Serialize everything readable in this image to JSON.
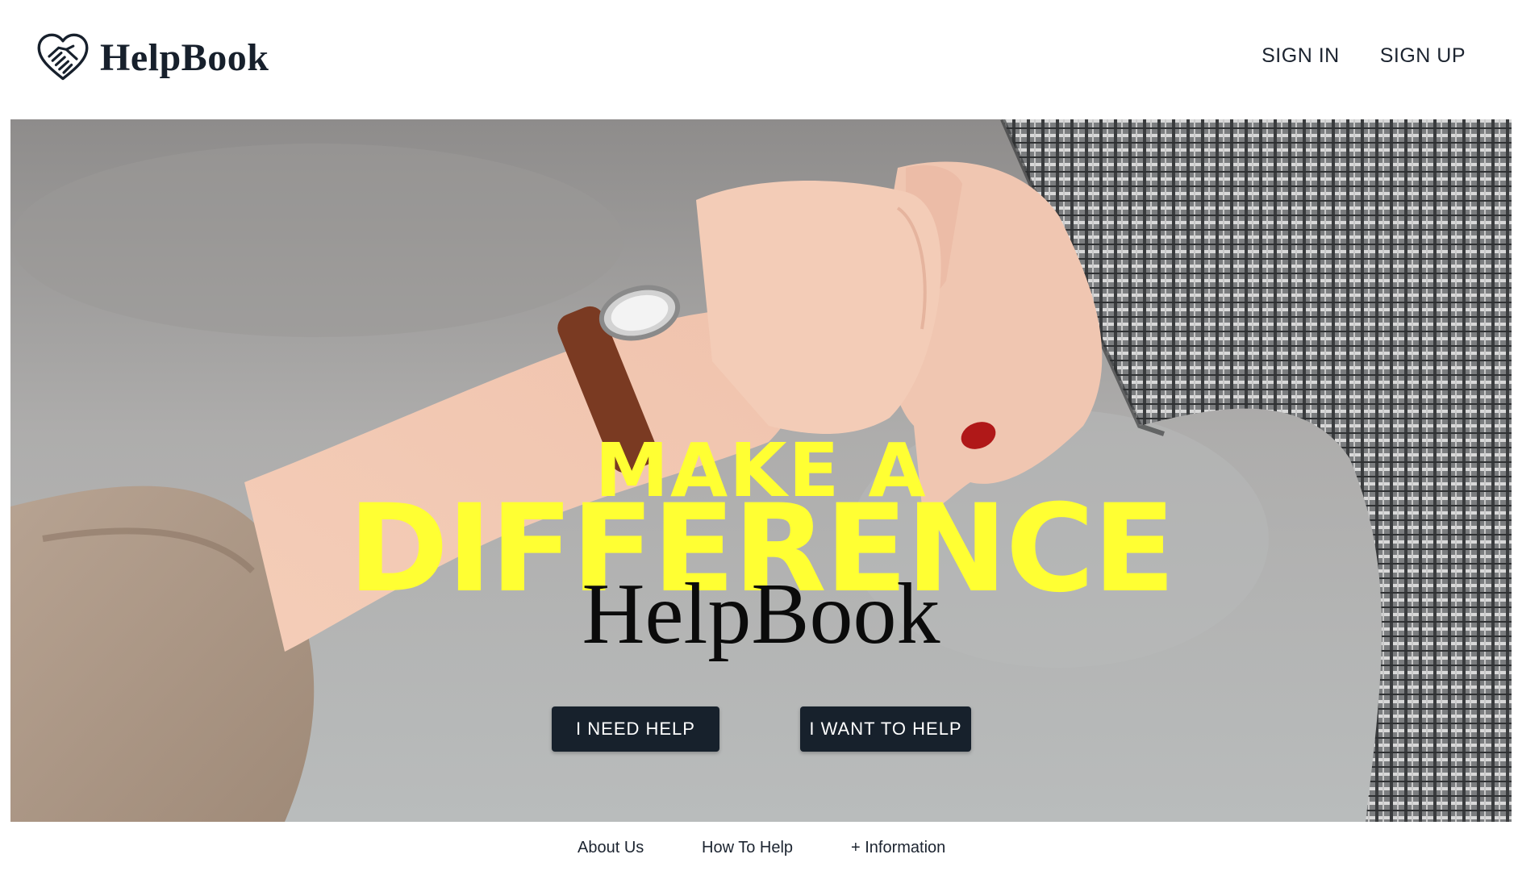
{
  "header": {
    "brand_name": "HelpBook",
    "logo_icon": "heart-handshake-icon",
    "nav": {
      "sign_in": "SIGN IN",
      "sign_up": "SIGN UP"
    }
  },
  "hero": {
    "title_line1": "MAKE A",
    "title_line2": "DIFFERENCE",
    "brand": "HelpBook",
    "image": "fist-bump-photo",
    "title_color": "#ffff33",
    "buttons": {
      "need_help": "I NEED HELP",
      "want_to_help": "I WANT TO HELP"
    },
    "button_color": "#17212c"
  },
  "footer": {
    "links": {
      "about": "About Us",
      "how": "How To Help",
      "info": "+ Information"
    }
  }
}
